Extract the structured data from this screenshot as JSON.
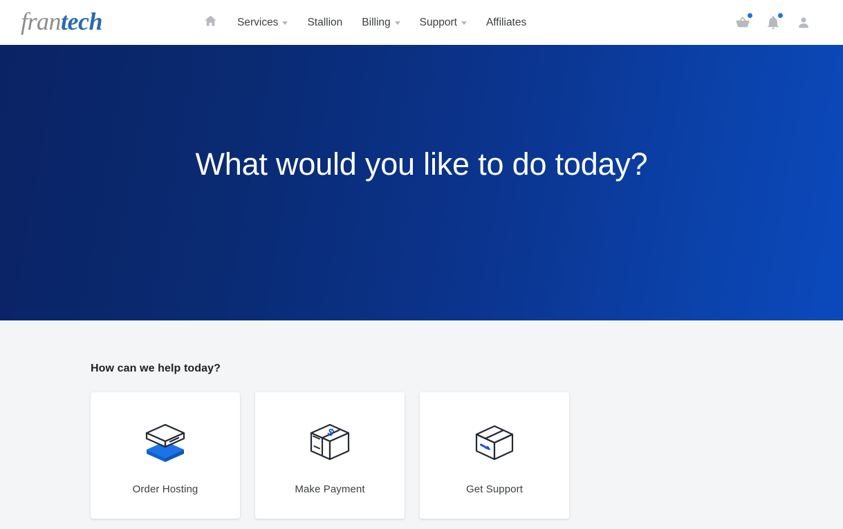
{
  "brand": {
    "part1": "fran",
    "part2": "tech",
    "color_gray": "#8d8d8d",
    "color_blue": "#2a6bb0"
  },
  "nav": {
    "home_icon": "home-icon",
    "items": [
      {
        "label": "Services",
        "has_dropdown": true
      },
      {
        "label": "Stallion",
        "has_dropdown": false
      },
      {
        "label": "Billing",
        "has_dropdown": true
      },
      {
        "label": "Support",
        "has_dropdown": true
      },
      {
        "label": "Affiliates",
        "has_dropdown": false
      }
    ],
    "right_icons": [
      {
        "name": "shopping-basket-icon",
        "badge": true
      },
      {
        "name": "notification-bell-icon",
        "badge": true
      },
      {
        "name": "user-account-icon",
        "badge": false
      }
    ],
    "badge_color": "#1a73e8"
  },
  "hero": {
    "title": "What would you like to do today?",
    "gradient_from": "#0a2364",
    "gradient_to": "#0b49bb"
  },
  "main": {
    "section_title": "How can we help today?",
    "cards": [
      {
        "label": "Order Hosting",
        "icon": "server-stack-isometric-icon",
        "accent": "#1a73e8"
      },
      {
        "label": "Make Payment",
        "icon": "box-dollar-isometric-icon",
        "accent": "#1a56d6"
      },
      {
        "label": "Get Support",
        "icon": "open-box-arrow-isometric-icon",
        "accent": "#1a56d6"
      }
    ]
  },
  "colors": {
    "page_background": "#f4f5f7",
    "card_background": "#ffffff",
    "text_primary": "#202124",
    "text_secondary": "#3c4043"
  }
}
